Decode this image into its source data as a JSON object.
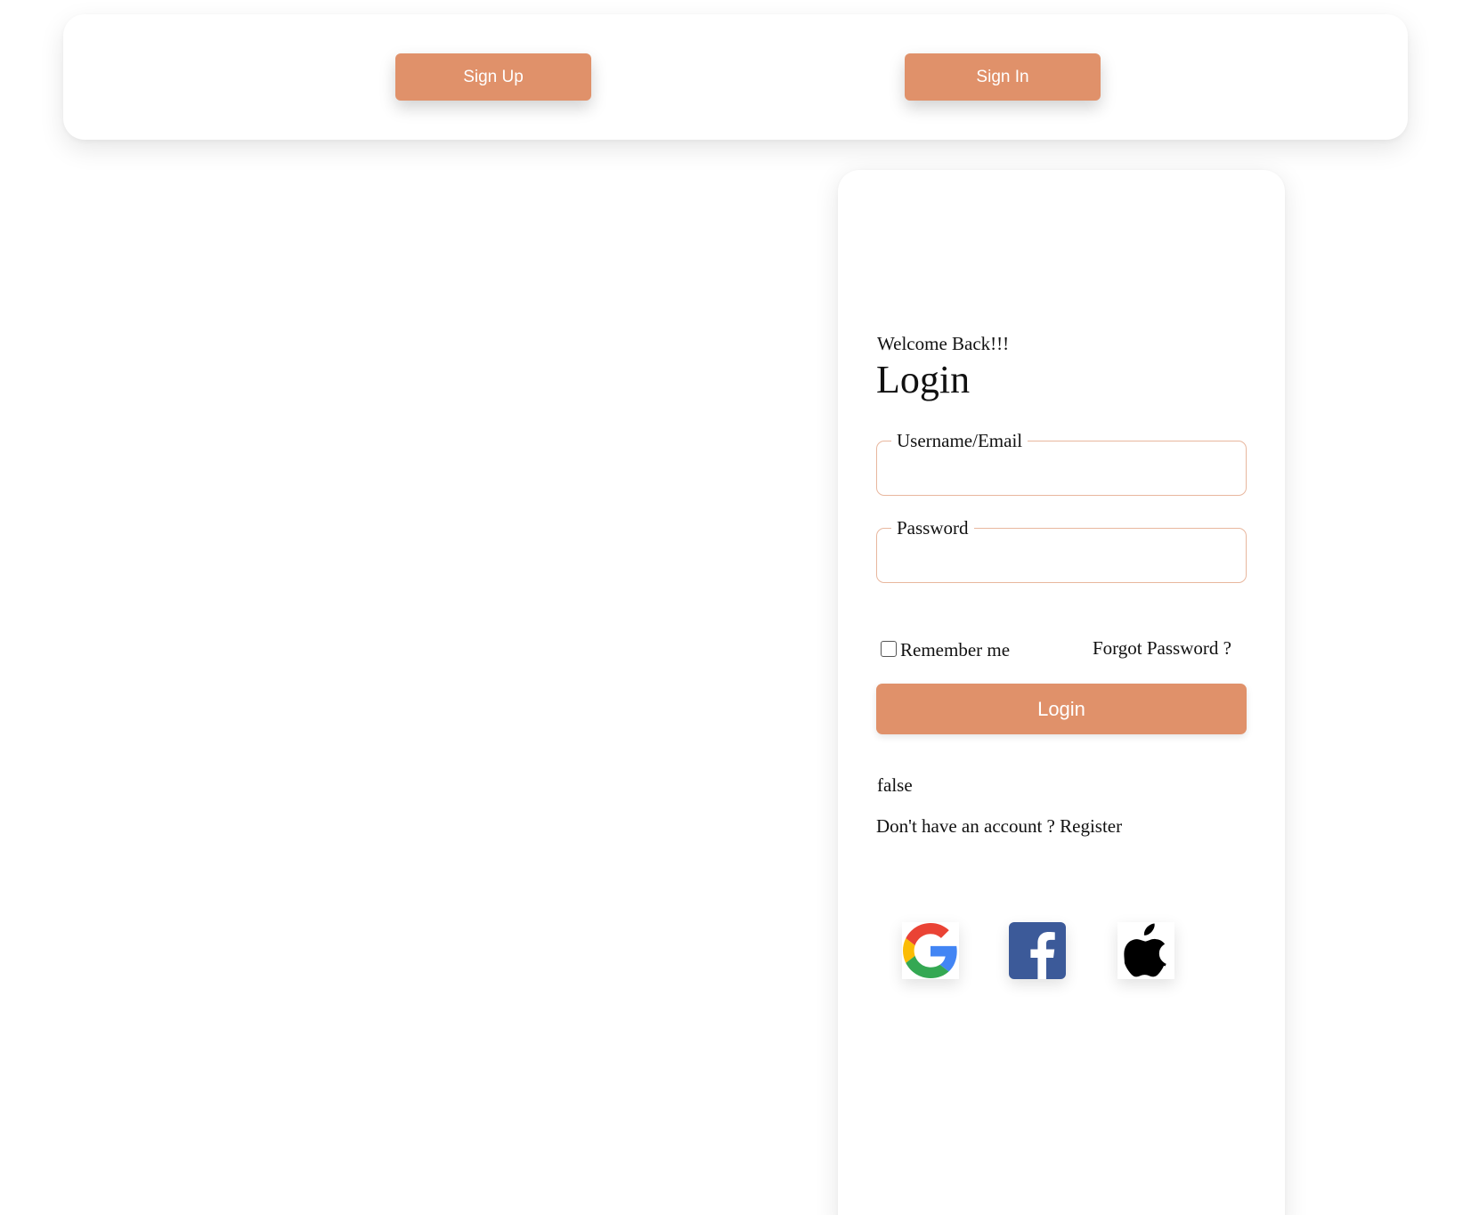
{
  "nav": {
    "signup_label": "Sign Up",
    "signin_label": "Sign In"
  },
  "login": {
    "welcome": "Welcome Back!!!",
    "title": "Login",
    "username_legend": "Username/Email",
    "username_value": "",
    "password_legend": "Password",
    "password_value": "",
    "remember_label": "Remember me",
    "remember_checked": false,
    "forgot_label": "Forgot Password ?",
    "submit_label": "Login",
    "status_text": "false",
    "no_account_text": "Don't have an account ?",
    "register_label": "Register"
  },
  "social": [
    {
      "icon": "google-icon"
    },
    {
      "icon": "facebook-icon"
    },
    {
      "icon": "apple-icon"
    }
  ],
  "colors": {
    "accent": "#e0916a",
    "field_border": "#e8b79e",
    "facebook_blue": "#3c5a99"
  }
}
